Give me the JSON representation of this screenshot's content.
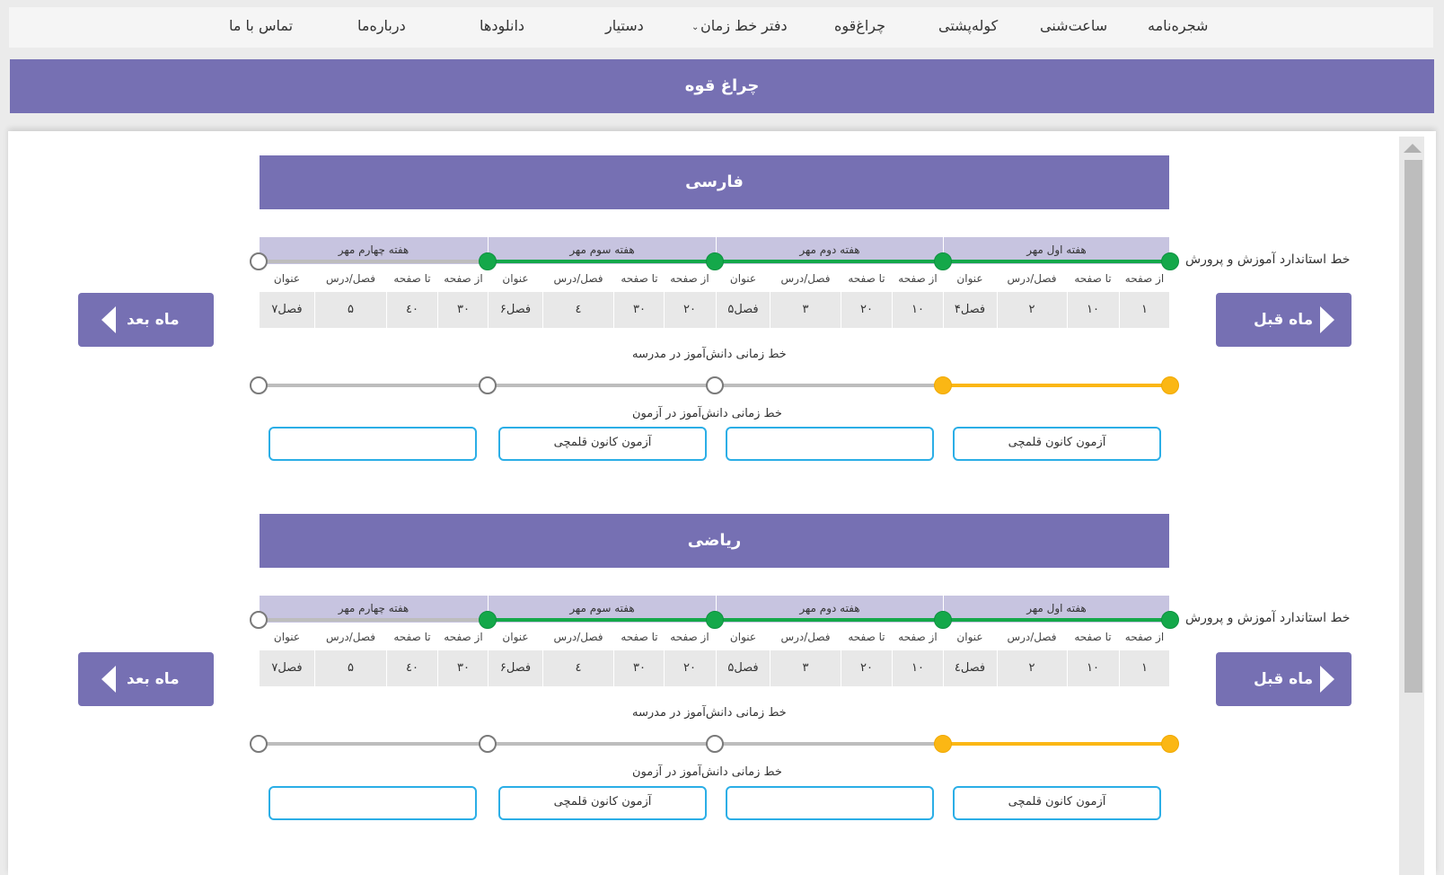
{
  "nav": {
    "items": [
      "شجره‌نامه",
      "ساعت‌شنی",
      "کوله‌پشتی",
      "چراغ‌قوه",
      "دفتر خط زمان",
      "دستیار",
      "دانلودها",
      "درباره‌ما",
      "تماس با ما"
    ]
  },
  "page_title": "چراغ قوه",
  "labels": {
    "standard_line": "خط استاندارد آموزش و پرورش",
    "school_line": "خط زمانی دانش‌آموز در مدرسه",
    "exam_line": "خط زمانی دانش‌آموز در آزمون",
    "prev_month": "ماه قبل",
    "next_month": "ماه بعد",
    "col_from": "از صفحه",
    "col_to": "تا صفحه",
    "col_chapter": "فصل/درس",
    "col_title": "عنوان"
  },
  "weeks": [
    "هفته اول مهر",
    "هفته دوم مهر",
    "هفته سوم مهر",
    "هفته چهارم مهر"
  ],
  "sections": [
    {
      "title": "فارسی",
      "rows": [
        {
          "from": "۱",
          "to": "۱۰",
          "chapter": "۲",
          "name": "فصل۴"
        },
        {
          "from": "۱۰",
          "to": "۲۰",
          "chapter": "۳",
          "name": "فصل۵"
        },
        {
          "from": "۲۰",
          "to": "۳۰",
          "chapter": "٤",
          "name": "فصل۶"
        },
        {
          "from": "۳۰",
          "to": "٤۰",
          "chapter": "۵",
          "name": "فصل۷"
        }
      ],
      "exams": [
        "آزمون کانون قلمچی",
        "",
        "آزمون کانون قلمچی",
        ""
      ]
    },
    {
      "title": "ریاضی",
      "rows": [
        {
          "from": "۱",
          "to": "۱۰",
          "chapter": "۲",
          "name": "فصل٤"
        },
        {
          "from": "۱۰",
          "to": "۲۰",
          "chapter": "۳",
          "name": "فصل۵"
        },
        {
          "from": "۲۰",
          "to": "۳۰",
          "chapter": "٤",
          "name": "فصل۶"
        },
        {
          "from": "۳۰",
          "to": "٤۰",
          "chapter": "۵",
          "name": "فصل۷"
        }
      ],
      "exams": [
        "آزمون کانون قلمچی",
        "",
        "آزمون کانون قلمچی",
        ""
      ]
    }
  ],
  "colors": {
    "purple": "#7670b3",
    "week_header": "#c7c4e0",
    "green": "#14a84a",
    "yellow": "#fbb714",
    "exam_border": "#2baee6"
  }
}
